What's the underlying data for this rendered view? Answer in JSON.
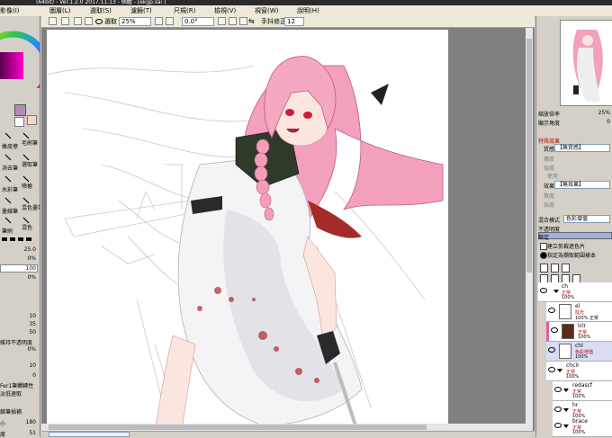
{
  "titlebar": {
    "text": "(64bit) - Ver.1.2.0 2017.11.13 - 個體 - [ekgp.sai ]"
  },
  "menu": [
    {
      "label": "影像(I)"
    },
    {
      "label": "圖層(L)"
    },
    {
      "label": "選取(S)"
    },
    {
      "label": "濾鏡(T)"
    },
    {
      "label": "尺規(R)"
    },
    {
      "label": "檢視(V)"
    },
    {
      "label": "視窗(W)"
    },
    {
      "label": "說明(H)"
    }
  ],
  "toolbar": {
    "select_label": "選取",
    "zoom": "25%",
    "angle": "0.0°",
    "stabilizer_label": "手抖修正",
    "stabilizer": "12"
  },
  "left": {
    "brush_labels": [
      "毛刷筆",
      "橡皮擦",
      "選取筆",
      "消去筆",
      "噴槍",
      "水彩筆",
      "混色畫筆",
      "墨線筆",
      "混色",
      "筆刷",
      "雲筆",
      "鉛筆",
      "素描筆",
      "平筆",
      "沾水筆",
      "水彩水"
    ],
    "size": "25.0",
    "size_pct": "0%",
    "density": "100",
    "density_pct": "0%",
    "val_10a": "10",
    "val_35": "35",
    "val_50": "50",
    "keep_opacity_label": "維持不透明度",
    "pct_0": "0%",
    "val_10b": "10",
    "val_0": "0",
    "paper_texture_label": "Fer1筆觸轉性",
    "low_res_label": "淡低速取",
    "spread_label": "鎖筆插補",
    "size_min_label": "小",
    "size_min": "180",
    "density_label": "度",
    "density_val": "51",
    "val_100": "100"
  },
  "right": {
    "zoom_label": "縮放倍率",
    "zoom_val": "25%",
    "angle_label": "顯示角度",
    "angle_val": "0",
    "effects_header": "特殊效果",
    "texture_label": "質感",
    "texture_val": "【無質感】",
    "scale_label": "擴度",
    "intensity_label": "強度",
    "use_label": "使用",
    "effect_label": "效果",
    "effect_val": "【無效果】",
    "width_label": "寬度",
    "strength_label": "強度",
    "blend_label": "混合模式",
    "blend_val": "色彩增值",
    "opacity_label": "不透明度",
    "lock_label": "鎖定",
    "clip_label": "建立剪裁遮色片",
    "ref_label": "指定為擷取範圍樣本"
  },
  "layers": [
    {
      "name": "ch",
      "mode": "正常",
      "op": "100%",
      "folder": true
    },
    {
      "name": "el",
      "mode": "陰光",
      "op": "100% 正常",
      "folder": false
    },
    {
      "name": "lclr",
      "mode": "正常",
      "op": "100%",
      "folder": false
    },
    {
      "name": "chl",
      "mode": "色彩增值",
      "op": "100%",
      "folder": false
    },
    {
      "name": "chclr",
      "mode": "正常",
      "op": "100%",
      "folder": true
    },
    {
      "name": "redascf",
      "mode": "正常",
      "op": "100%",
      "folder": true
    },
    {
      "name": "hr",
      "mode": "正常",
      "op": "100%",
      "folder": true
    },
    {
      "name": "brace",
      "mode": "正常",
      "op": "100%",
      "folder": true
    }
  ],
  "colors": {
    "accent": "#f2a0bb",
    "swatch": "#b28bb6",
    "canvas_bg": "#ffffff"
  }
}
